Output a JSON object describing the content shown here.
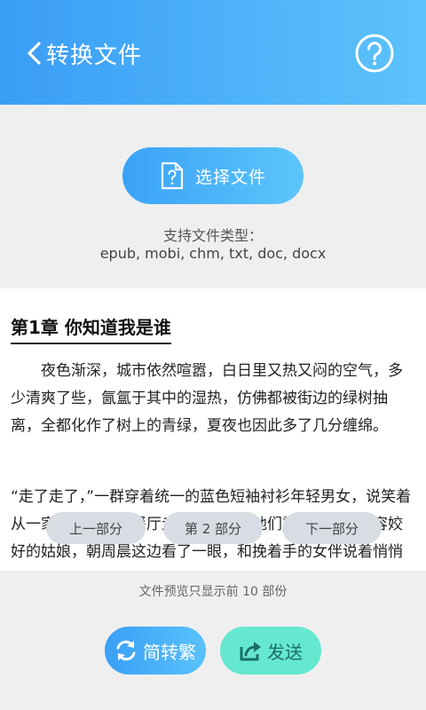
{
  "header": {
    "title": "转换文件",
    "back_icon": "chevron-left-icon",
    "help_icon": "question-circle-icon"
  },
  "upload": {
    "button_label": "选择文件",
    "button_icon": "file-question-icon",
    "support_title": "支持文件类型：",
    "support_types": "epub, mobi, chm, txt, doc, docx"
  },
  "preview": {
    "chapter_title": "第1章 你知道我是谁",
    "paragraphs": [
      "夜色渐深，城市依然喧嚣，白日里又热又闷的空气，多少清爽了些，氤氲于其中的湿热，仿佛都被街边的绿树抽离，全都化作了树上的青绿，夏夜也因此多了几分缠绵。",
      "“走了走了，”一群穿着统一的蓝色短袖衬衫年轻男女，说笑着从一家装潢典雅的餐厅走出，灯光将他们染成金色，面容姣好的姑娘，朝周晨这边看了一眼，和挽着手的女伴说着悄悄话，两人便齐齐咯咯的笑了起来。"
    ]
  },
  "pager": {
    "prev": "上一部分",
    "current": "第 2 部分",
    "next": "下一部分"
  },
  "notice": "文件预览只显示前 10 部份",
  "actions": {
    "convert_label": "简转繁",
    "convert_icon": "swap-arrows-icon",
    "send_label": "发送",
    "send_icon": "share-icon"
  },
  "colors": {
    "header_start": "#3a9df6",
    "header_end": "#5cc3fb",
    "send_bg": "#66e8d0"
  }
}
